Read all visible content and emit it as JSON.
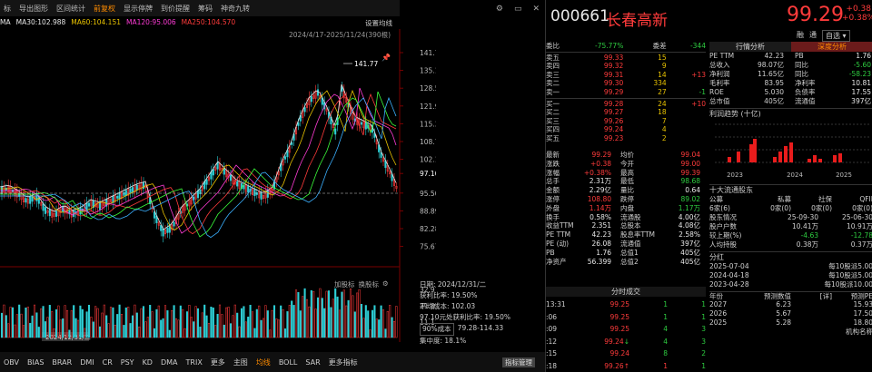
{
  "toolbar": {
    "items": [
      "标",
      "导出图形",
      "区间统计",
      "前复权",
      "显示停牌",
      "到价提醒",
      "筹码",
      "神奇九转"
    ],
    "active_index": 3
  },
  "ma": {
    "label": "MA",
    "items": [
      {
        "text": "MA30:102.988",
        "color": "#e8e8e8"
      },
      {
        "text": "MA60:104.151",
        "color": "#e8c200"
      },
      {
        "text": "MA120:95.006",
        "color": "#ff3bd6"
      },
      {
        "text": "MA250:104.570",
        "color": "#ff3b3b"
      }
    ]
  },
  "chart_top": {
    "settings": "设置均线",
    "range": "2024/4/17-2025/11/24(390根)",
    "high_mark": "141.77"
  },
  "price_axis": [
    "141.77",
    "135.16",
    "128.55",
    "121.94",
    "115.33",
    "108.72",
    "102.11",
    "97.10",
    "95.50",
    "88.89",
    "82.28",
    "75.67"
  ],
  "volume_axis": [
    "32.9万",
    "21.8万",
    "11.1万"
  ],
  "x_axis": {
    "labels": [
      "12",
      "03",
      "04",
      "05",
      "06",
      "07",
      "08",
      "09",
      "10",
      "11"
    ],
    "date_box": "2024/12/31/二"
  },
  "cost_dist": {
    "date": "日期: 2024/12/31/二",
    "profit_ratio": "获利比率: 19.50%",
    "avg_cost": "平均成本: 102.03",
    "profit_at": "97.10元处获利比率: 19.50%",
    "cost_90_label": "90%成本",
    "cost_90": "79.28-114.33",
    "concentration": "集中度: 18.1%",
    "actions": [
      "加股标",
      "换股标"
    ],
    "manage": "指标管理"
  },
  "bottom_tabs": {
    "items": [
      "OBV",
      "BIAS",
      "BRAR",
      "DMI",
      "CR",
      "PSY",
      "KD",
      "DMA",
      "TRIX",
      "更多",
      "主图",
      "均线",
      "BOLL",
      "SAR",
      "更多指标"
    ],
    "active_index": 11
  },
  "quote": {
    "code": "000661",
    "name": "长春高新",
    "price": "99.29",
    "change": "+0.38",
    "change_pct": "+0.38%",
    "badges": [
      "融",
      "通"
    ],
    "selector": "自选"
  },
  "order_book": {
    "wb_label": "委比",
    "wb": "-75.77%",
    "wc_label": "委差",
    "wc": "-344",
    "asks": [
      {
        "label": "卖五",
        "price": "99.33",
        "vol": "15",
        "chg": ""
      },
      {
        "label": "卖四",
        "price": "99.32",
        "vol": "9",
        "chg": ""
      },
      {
        "label": "卖三",
        "price": "99.31",
        "vol": "14",
        "chg": "+13"
      },
      {
        "label": "卖二",
        "price": "99.30",
        "vol": "334",
        "chg": ""
      },
      {
        "label": "卖一",
        "price": "99.29",
        "vol": "27",
        "chg": "-1"
      }
    ],
    "bids": [
      {
        "label": "买一",
        "price": "99.28",
        "vol": "24",
        "chg": "+10"
      },
      {
        "label": "买二",
        "price": "99.27",
        "vol": "18",
        "chg": ""
      },
      {
        "label": "买三",
        "price": "99.26",
        "vol": "7",
        "chg": ""
      },
      {
        "label": "买四",
        "price": "99.24",
        "vol": "4",
        "chg": ""
      },
      {
        "label": "买五",
        "price": "99.23",
        "vol": "2",
        "chg": ""
      }
    ]
  },
  "stats": [
    {
      "l1": "最新",
      "v1": "99.29",
      "c1": "red",
      "l2": "均价",
      "v2": "99.04",
      "c2": "red"
    },
    {
      "l1": "涨跌",
      "v1": "+0.38",
      "c1": "red",
      "l2": "今开",
      "v2": "99.00",
      "c2": "red"
    },
    {
      "l1": "涨幅",
      "v1": "+0.38%",
      "c1": "red",
      "l2": "最高",
      "v2": "99.39",
      "c2": "red"
    },
    {
      "l1": "总手",
      "v1": "2.31万",
      "c1": "white",
      "l2": "最低",
      "v2": "98.68",
      "c2": "green"
    },
    {
      "l1": "金额",
      "v1": "2.29亿",
      "c1": "white",
      "l2": "量比",
      "v2": "0.64",
      "c2": "white"
    },
    {
      "l1": "涨停",
      "v1": "108.80",
      "c1": "red",
      "l2": "跌停",
      "v2": "89.02",
      "c2": "green"
    },
    {
      "l1": "外盘",
      "v1": "1.14万",
      "c1": "red",
      "l2": "内盘",
      "v2": "1.17万",
      "c2": "green"
    },
    {
      "l1": "换手",
      "v1": "0.58%",
      "c1": "white",
      "l2": "流通股",
      "v2": "4.00亿",
      "c2": "white"
    },
    {
      "l1": "收益TTM",
      "v1": "2.351",
      "c1": "white",
      "l2": "总股本",
      "v2": "4.08亿",
      "c2": "white"
    },
    {
      "l1": "PE TTM",
      "v1": "42.23",
      "c1": "white",
      "l2": "股息率TTM",
      "v2": "2.58%",
      "c2": "white"
    },
    {
      "l1": "PE (动)",
      "v1": "26.08",
      "c1": "white",
      "l2": "流通值",
      "v2": "397亿",
      "c2": "white"
    },
    {
      "l1": "PB",
      "v1": "1.76",
      "c1": "white",
      "l2": "总值1",
      "v2": "405亿",
      "c2": "white"
    },
    {
      "l1": "净资产",
      "v1": "56.399",
      "c1": "white",
      "l2": "总值2",
      "v2": "405亿",
      "c2": "white"
    }
  ],
  "ticks": {
    "title": "分时成交",
    "rows": [
      {
        "t": "13:31",
        "p": "99.25",
        "a": "",
        "v": "1",
        "n": "1",
        "pc": "red",
        "vc": "green"
      },
      {
        "t": ":06",
        "p": "99.25",
        "a": "",
        "v": "1",
        "n": "1",
        "pc": "red",
        "vc": "green"
      },
      {
        "t": ":09",
        "p": "99.25",
        "a": "",
        "v": "4",
        "n": "3",
        "pc": "red",
        "vc": "green"
      },
      {
        "t": ":12",
        "p": "99.24",
        "a": "↓",
        "v": "4",
        "n": "3",
        "pc": "red",
        "vc": "green"
      },
      {
        "t": ":15",
        "p": "99.24",
        "a": "",
        "v": "8",
        "n": "2",
        "pc": "red",
        "vc": "green"
      },
      {
        "t": ":18",
        "p": "99.26",
        "a": "↑",
        "v": "1",
        "n": "1",
        "pc": "red",
        "vc": "red"
      }
    ]
  },
  "right_panel": {
    "tabs": [
      "行情分析",
      "深度分析"
    ],
    "active_tab": 1,
    "fin": [
      {
        "a": "PE TTM",
        "b": "42.23",
        "c": "PB",
        "d": "1.76",
        "dc": "white"
      },
      {
        "a": "总收入",
        "b": "98.07亿",
        "c": "同比",
        "d": "-5.60",
        "dc": "green"
      },
      {
        "a": "净利润",
        "b": "11.65亿",
        "c": "同比",
        "d": "-58.23",
        "dc": "green"
      },
      {
        "a": "毛利率",
        "b": "83.95",
        "c": "净利率",
        "d": "10.81",
        "dc": "white"
      },
      {
        "a": "ROE",
        "b": "5.030",
        "c": "负债率",
        "d": "17.55",
        "dc": "white"
      },
      {
        "a": "总市值",
        "b": "405亿",
        "c": "流通值",
        "d": "397亿",
        "dc": "white"
      }
    ],
    "profit_title": "利润趋势 (十亿)",
    "profit_chart": {
      "type": "bar",
      "categories": [
        "2023",
        "2024",
        "2025"
      ],
      "bar_color": "#e81c1c"
    },
    "holders_title": "十大流通股东",
    "holders_head": [
      "公募",
      "私募",
      "社保",
      "QFII"
    ],
    "holders_vals": [
      "6家(6)",
      "0家(0)",
      "0家(0)",
      "0家(0)"
    ],
    "sh_rows": [
      [
        "股东情况",
        "25-09-30",
        "25-06-30"
      ],
      [
        "股户户数",
        "10.41万",
        "10.91万"
      ],
      [
        "较上期(%)",
        "-4.63",
        "-12.78"
      ],
      [
        "人均持股",
        "0.38万",
        "0.37万"
      ]
    ],
    "div_title": "分红",
    "div_rows": [
      [
        "2025-07-04",
        "每10股派5.00"
      ],
      [
        "2024-04-18",
        "每10股派5.00"
      ],
      [
        "2023-04-28",
        "每10股派10.00"
      ]
    ],
    "fc_head": [
      "年份",
      "预测数值",
      "[详]",
      "预测PE"
    ],
    "fc_rows": [
      [
        "2027",
        "6.23",
        "",
        "15.93"
      ],
      [
        "2026",
        "5.67",
        "",
        "17.50"
      ],
      [
        "2025",
        "5.28",
        "",
        "18.80"
      ]
    ],
    "fc_more": [
      "",
      "",
      "",
      "机构名称"
    ]
  }
}
